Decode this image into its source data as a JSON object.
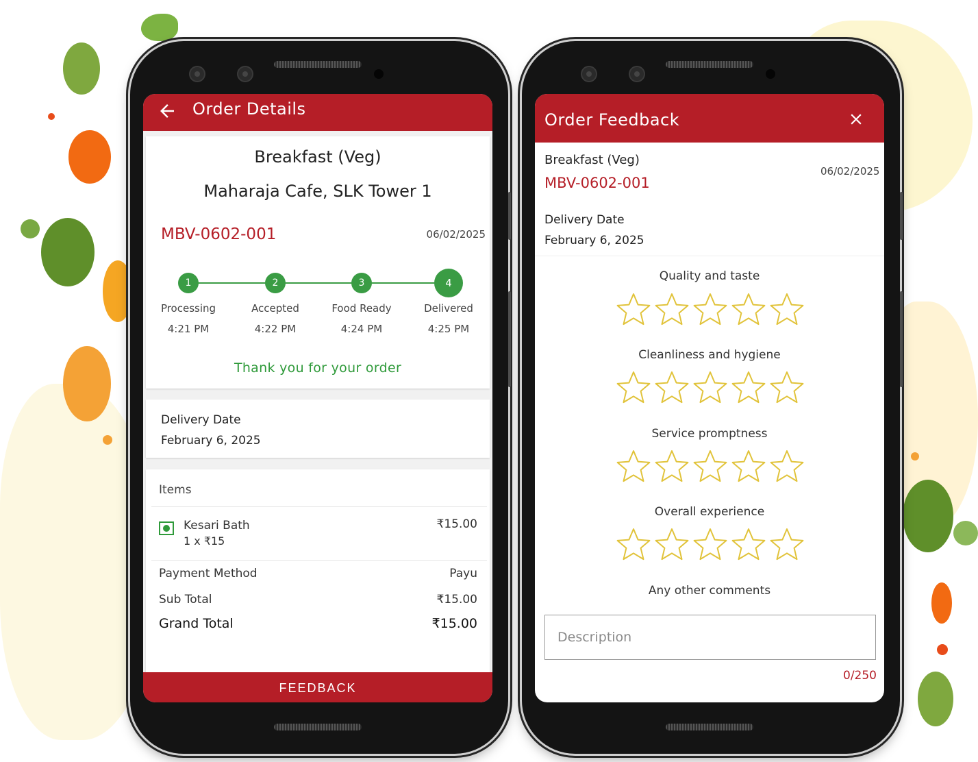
{
  "colors": {
    "brand": "#b51e27",
    "success": "#2f9a3a",
    "star_outline": "#e1c33a"
  },
  "order_details": {
    "title": "Order Details",
    "back_icon": "arrow-left-icon",
    "meal": "Breakfast (Veg)",
    "cafe": "Maharaja Cafe, SLK Tower 1",
    "order_id": "MBV-0602-001",
    "order_date": "06/02/2025",
    "progress": {
      "steps": [
        {
          "number": "1",
          "label": "Processing",
          "time": "4:21 PM"
        },
        {
          "number": "2",
          "label": "Accepted",
          "time": "4:22 PM"
        },
        {
          "number": "3",
          "label": "Food Ready",
          "time": "4:24 PM"
        },
        {
          "number": "4",
          "label": "Delivered",
          "time": "4:25 PM"
        }
      ],
      "current_step": 4
    },
    "thank_you": "Thank you for your order",
    "delivery": {
      "label": "Delivery Date",
      "value": "February 6, 2025"
    },
    "items_header": "Items",
    "items": [
      {
        "name": "Kesari Bath",
        "qty": "1 x ₹15",
        "price": "₹15.00",
        "icon": "veg-indicator-icon"
      }
    ],
    "payment": {
      "label": "Payment Method",
      "value": "Payu"
    },
    "sub_total": {
      "label": "Sub Total",
      "value": "₹15.00"
    },
    "grand_total": {
      "label": "Grand Total",
      "value": "₹15.00"
    },
    "feedback_button": "FEEDBACK"
  },
  "order_feedback": {
    "title": "Order Feedback",
    "close_icon": "close-icon",
    "meal": "Breakfast (Veg)",
    "order_id": "MBV-0602-001",
    "order_date": "06/02/2025",
    "delivery": {
      "label": "Delivery Date",
      "value": "February 6, 2025"
    },
    "questions": [
      {
        "label": "Quality and taste",
        "rating": 0,
        "max": 5
      },
      {
        "label": "Cleanliness and hygiene",
        "rating": 0,
        "max": 5
      },
      {
        "label": "Service promptness",
        "rating": 0,
        "max": 5
      },
      {
        "label": "Overall experience",
        "rating": 0,
        "max": 5
      }
    ],
    "comments_label": "Any other comments",
    "comments_placeholder": "Description",
    "comments_value": "",
    "char_counter": "0/250"
  }
}
